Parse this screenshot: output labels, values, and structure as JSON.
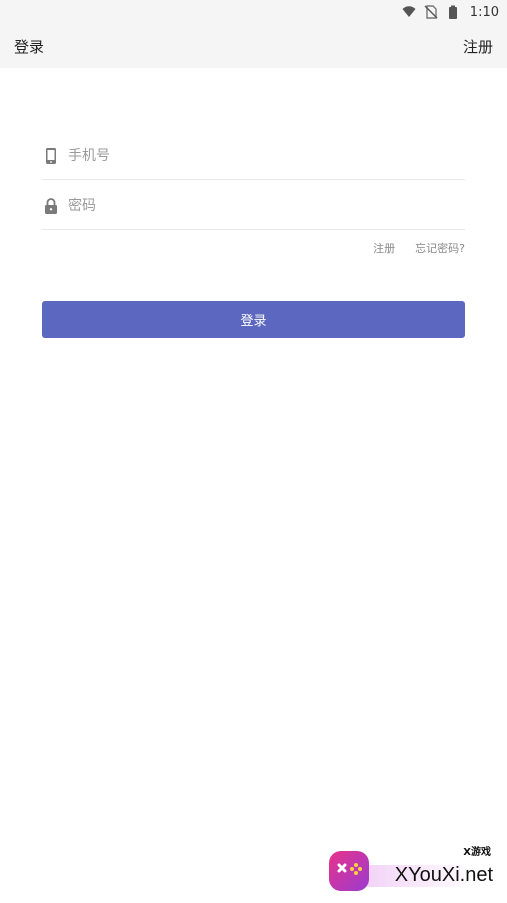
{
  "status_bar": {
    "time": "1:10",
    "icons": [
      "wifi-icon",
      "no-sim-icon",
      "battery-icon"
    ]
  },
  "top_bar": {
    "title": "登录",
    "register_action": "注册"
  },
  "form": {
    "phone": {
      "placeholder": "手机号",
      "value": "",
      "icon": "phone-icon"
    },
    "password": {
      "placeholder": "密码",
      "value": "",
      "icon": "lock-icon"
    },
    "register_link": "注册",
    "forgot_link": "忘记密码?"
  },
  "login_button": {
    "label": "登录"
  },
  "watermark": {
    "text": "XYouXi.net",
    "sub": "X游戏"
  },
  "colors": {
    "primary": "#5c68bf",
    "bar_bg": "#f5f5f5",
    "divider": "#e8e8e8",
    "muted_text": "#888888"
  }
}
